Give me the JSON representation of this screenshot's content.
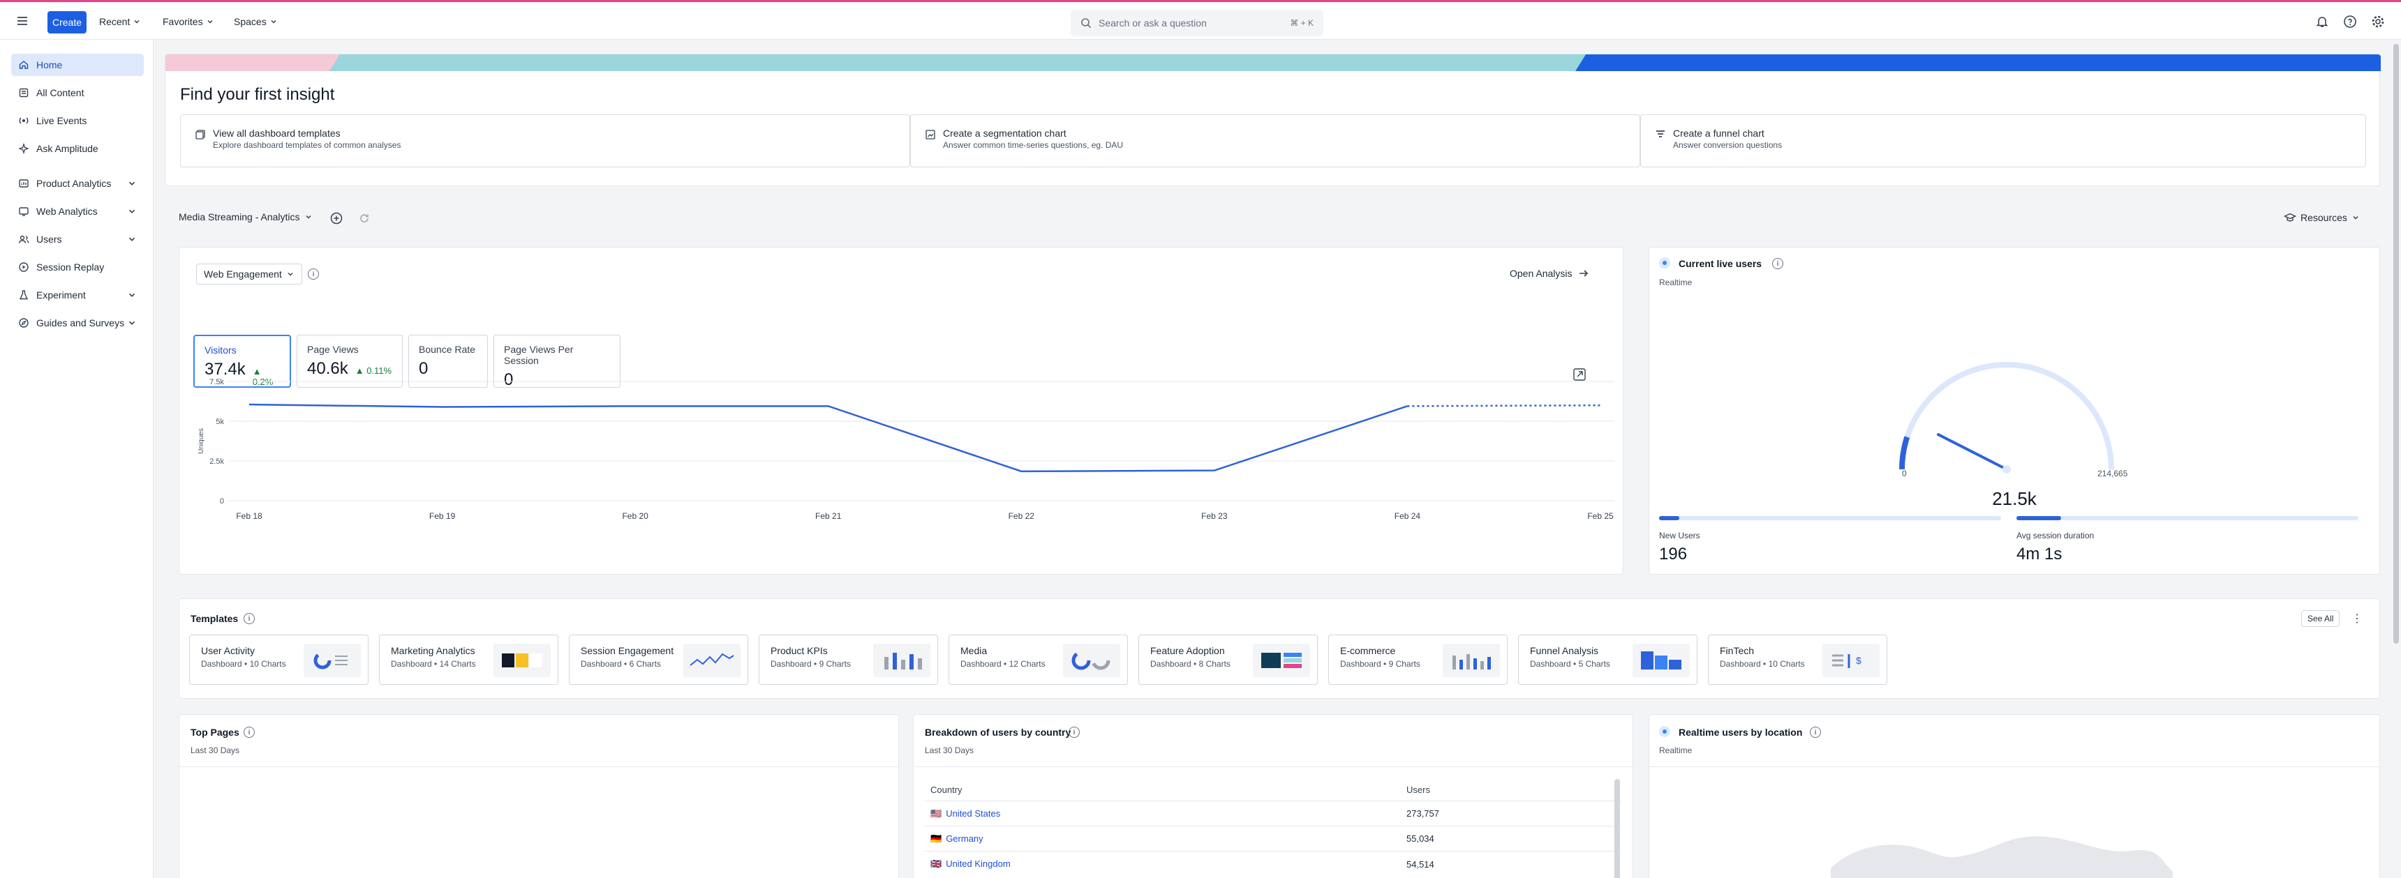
{
  "topbar": {
    "create": "Create",
    "recent": "Recent",
    "favorites": "Favorites",
    "spaces": "Spaces",
    "search_placeholder": "Search or ask a question",
    "search_shortcut": "⌘ + K"
  },
  "sidebar": {
    "items": [
      {
        "label": "Home",
        "icon": "home-icon"
      },
      {
        "label": "All Content",
        "icon": "content-icon"
      },
      {
        "label": "Live Events",
        "icon": "live-events-icon"
      },
      {
        "label": "Ask Amplitude",
        "icon": "ask-icon"
      },
      {
        "label": "Product Analytics",
        "icon": "product-analytics-icon"
      },
      {
        "label": "Web Analytics",
        "icon": "web-analytics-icon"
      },
      {
        "label": "Users",
        "icon": "users-icon"
      },
      {
        "label": "Session Replay",
        "icon": "session-replay-icon"
      },
      {
        "label": "Experiment",
        "icon": "experiment-icon"
      },
      {
        "label": "Guides and Surveys",
        "icon": "guides-icon"
      }
    ]
  },
  "insight": {
    "title": "Find your first insight",
    "options": [
      {
        "title": "View all dashboard templates",
        "sub": "Explore dashboard templates of common analyses"
      },
      {
        "title": "Create a segmentation chart",
        "sub": "Answer common time-series questions, eg. DAU"
      },
      {
        "title": "Create a funnel chart",
        "sub": "Answer conversion questions"
      }
    ]
  },
  "dashboard": {
    "name": "Media Streaming - Analytics",
    "resources": "Resources"
  },
  "web_engagement": {
    "selector": "Web Engagement",
    "open_analysis": "Open Analysis",
    "metrics": [
      {
        "label": "Visitors",
        "value": "37.4k",
        "delta": "0.2%"
      },
      {
        "label": "Page Views",
        "value": "40.6k",
        "delta": "0.11%"
      },
      {
        "label": "Bounce Rate",
        "value": "0",
        "delta": ""
      },
      {
        "label": "Page Views Per Session",
        "value": "0",
        "delta": ""
      }
    ]
  },
  "chart_data": {
    "type": "line",
    "ylabel": "Uniques",
    "y_ticks": [
      "7.5k",
      "5k",
      "2.5k",
      "0"
    ],
    "ylim": [
      0,
      7500
    ],
    "x": [
      "Feb 18",
      "Feb 19",
      "Feb 20",
      "Feb 21",
      "Feb 22",
      "Feb 23",
      "Feb 24",
      "Feb 25"
    ],
    "series": [
      {
        "values": [
          6050,
          5900,
          5950,
          5950,
          1850,
          1900,
          5950,
          6000
        ],
        "incomplete_from_index": 6
      }
    ],
    "color": "#2e62d9",
    "grid": true
  },
  "live_users": {
    "title": "Current live users",
    "sub": "Realtime",
    "gauge_min": "0",
    "gauge_max": "214,665",
    "value": "21.5k",
    "gauge_fraction": 0.1,
    "new_users_label": "New Users",
    "new_users": "196",
    "new_users_fraction": 0.06,
    "session_label": "Avg session duration",
    "session": "4m 1s",
    "session_fraction": 0.13
  },
  "templates": {
    "title": "Templates",
    "see_all": "See All",
    "items": [
      {
        "name": "User Activity",
        "sub": "Dashboard • 10 Charts"
      },
      {
        "name": "Marketing Analytics",
        "sub": "Dashboard • 14 Charts"
      },
      {
        "name": "Session Engagement",
        "sub": "Dashboard • 6 Charts"
      },
      {
        "name": "Product KPIs",
        "sub": "Dashboard • 9 Charts"
      },
      {
        "name": "Media",
        "sub": "Dashboard • 12 Charts"
      },
      {
        "name": "Feature Adoption",
        "sub": "Dashboard • 8 Charts"
      },
      {
        "name": "E-commerce",
        "sub": "Dashboard • 9 Charts"
      },
      {
        "name": "Funnel Analysis",
        "sub": "Dashboard • 5 Charts"
      },
      {
        "name": "FinTech",
        "sub": "Dashboard • 10 Charts"
      }
    ]
  },
  "top_pages": {
    "title": "Top Pages",
    "sub": "Last 30 Days"
  },
  "by_country": {
    "title": "Breakdown of users by country",
    "sub": "Last 30 Days",
    "col_country": "Country",
    "col_users": "Users",
    "rows": [
      {
        "flag": "🇺🇸",
        "country": "United States",
        "users": "273,757"
      },
      {
        "flag": "🇩🇪",
        "country": "Germany",
        "users": "55,034"
      },
      {
        "flag": "🇬🇧",
        "country": "United Kingdom",
        "users": "54,514"
      }
    ]
  },
  "by_location": {
    "title": "Realtime users by location",
    "sub": "Realtime"
  }
}
